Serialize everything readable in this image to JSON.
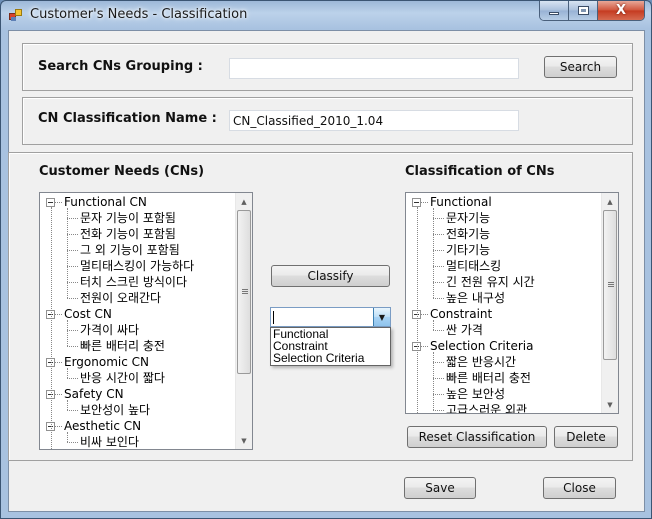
{
  "window": {
    "title": "Customer's Needs - Classification",
    "icons": {
      "app": "app-icon",
      "minimize": "minimize-icon",
      "maximize": "maximize-icon",
      "close": "close-icon"
    },
    "close_glyph": "X"
  },
  "search": {
    "label": "Search CNs Grouping :",
    "value": "",
    "placeholder": "",
    "button_label": "Search"
  },
  "classification_name": {
    "label": "CN Classification Name :",
    "value": "CN_Classified_2010_1.04"
  },
  "customer_needs": {
    "heading": "Customer Needs (CNs)",
    "groups": [
      {
        "label": "Functional CN",
        "expanded": true,
        "children": [
          "문자 기능이 포함됨",
          "전화 기능이 포함됨",
          "그 외 기능이 포함됨",
          "멀티태스킹이 가능하다",
          "터치 스크린 방식이다",
          "전원이 오래간다"
        ]
      },
      {
        "label": "Cost CN",
        "expanded": true,
        "children": [
          "가격이 싸다",
          "빠른 배터리 충전"
        ]
      },
      {
        "label": "Ergonomic CN",
        "expanded": true,
        "children": [
          "반응 시간이 짧다"
        ]
      },
      {
        "label": "Safety CN",
        "expanded": true,
        "children": [
          "보안성이 높다"
        ]
      },
      {
        "label": "Aesthetic CN",
        "expanded": true,
        "children": [
          "비싸 보인다"
        ]
      }
    ]
  },
  "classify": {
    "button_label": "Classify",
    "combo_value": "",
    "options": [
      "Functional",
      "Constraint",
      "Selection Criteria"
    ]
  },
  "classification": {
    "heading": "Classification of CNs",
    "groups": [
      {
        "label": "Functional",
        "expanded": true,
        "children": [
          "문자기능",
          "전화기능",
          "기타기능",
          "멀티태스킹",
          "긴 전원 유지 시간",
          "높은 내구성"
        ]
      },
      {
        "label": "Constraint",
        "expanded": true,
        "children": [
          "싼 가격"
        ]
      },
      {
        "label": "Selection Criteria",
        "expanded": true,
        "children": [
          "짧은 반응시간",
          "빠른 배터리 충전",
          "높은 보안성",
          "고급스러운 외관"
        ]
      }
    ],
    "reset_label": "Reset Classification",
    "delete_label": "Delete"
  },
  "footer": {
    "save_label": "Save",
    "close_label": "Close"
  }
}
